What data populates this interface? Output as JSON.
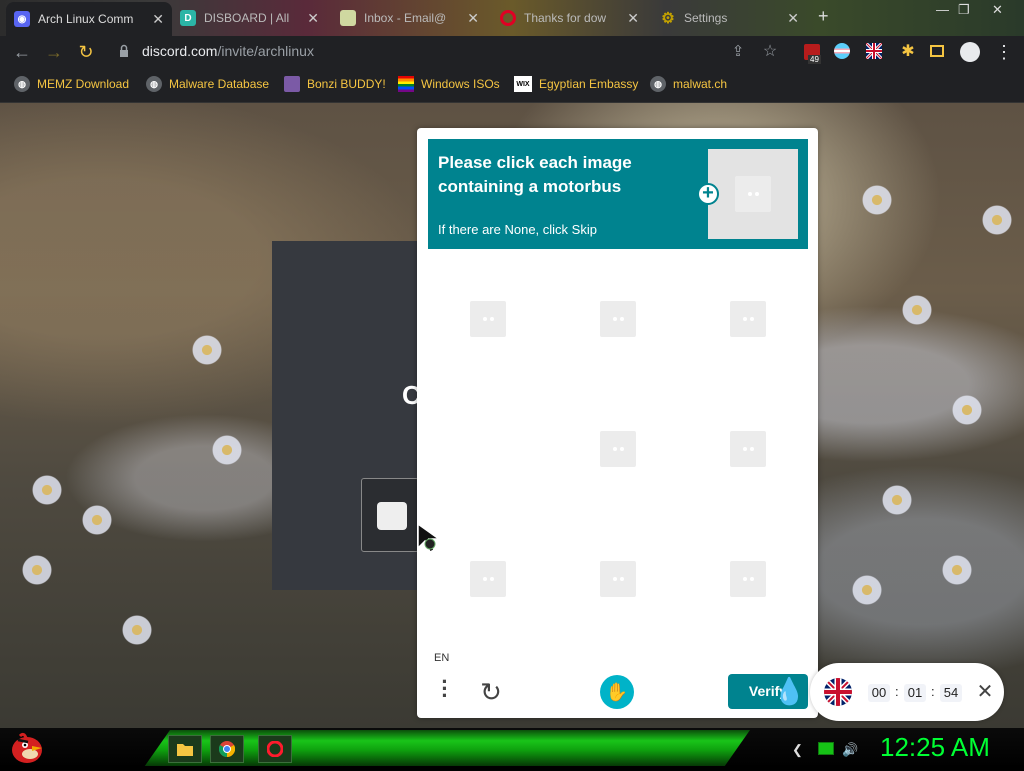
{
  "browser": {
    "tabs": [
      {
        "title": "Arch Linux Comm",
        "favicon": "discord-icon",
        "color": "#5865f2",
        "active": true
      },
      {
        "title": "DISBOARD | All",
        "favicon": "disboard-icon",
        "color": "#2bb5a6"
      },
      {
        "title": "Inbox - Email@",
        "favicon": "mail-icon",
        "color": "#cfd8a0"
      },
      {
        "title": "Thanks for dow",
        "favicon": "opera-icon",
        "color": "#e00024"
      },
      {
        "title": "Settings",
        "favicon": "settings-icon",
        "color": "#c2a000"
      }
    ],
    "url_host": "discord.com",
    "url_path": "/invite/archlinux",
    "ext_badge": "49",
    "bookmarks": [
      {
        "label": "MEMZ Download",
        "icon": "globe-icon"
      },
      {
        "label": "Malware Database",
        "icon": "globe-icon"
      },
      {
        "label": "Bonzi BUDDY!",
        "icon": "bonzi-icon"
      },
      {
        "label": "Windows ISOs",
        "icon": "rainbow-flag-icon"
      },
      {
        "label": "Egyptian Embassy",
        "icon": "wix-icon",
        "icon_text": "WIX"
      },
      {
        "label": "malwat.ch",
        "icon": "globe-icon"
      }
    ]
  },
  "page": {
    "partial_heading": "C"
  },
  "captcha": {
    "prompt": "Please click each image containing a motorbus",
    "subtext": "If there are None, click Skip",
    "lang": "EN",
    "verify_label": "Verify",
    "accent": "#00838f"
  },
  "timer": {
    "hours": "00",
    "minutes": "01",
    "seconds": "54",
    "separator": ":"
  },
  "taskbar": {
    "clock": "12:25 AM",
    "accent": "#00ff33"
  }
}
